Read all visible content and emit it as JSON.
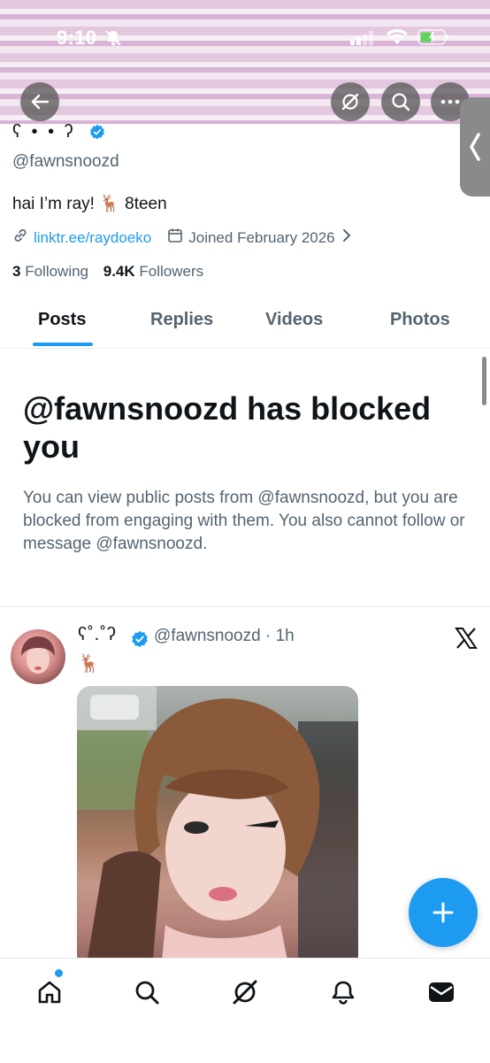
{
  "status_bar": {
    "time": "9:10"
  },
  "profile": {
    "display_name": "ʕ • • ʔ",
    "handle": "@fawnsnoozd",
    "bio": "hai I’m ray! 🦌 8teen",
    "link": "linktr.ee/raydoeko",
    "joined": "Joined February 2026",
    "following_count": "3",
    "following_label": "Following",
    "followers_count": "9.4K",
    "followers_label": "Followers"
  },
  "tabs": [
    {
      "label": "Posts",
      "active": true
    },
    {
      "label": "Replies",
      "active": false
    },
    {
      "label": "Videos",
      "active": false
    },
    {
      "label": "Photos",
      "active": false
    }
  ],
  "blocked": {
    "title": "@fawnsnoozd has blocked you",
    "description": "You can view public posts from @fawnsnoozd, but you are blocked from engaging with them. You also cannot follow or message @fawnsnoozd."
  },
  "post": {
    "author_name": "ʕ˚.˚ʔ",
    "handle_time": "@fawnsnoozd · 1h",
    "text": "🦌"
  },
  "colors": {
    "accent": "#1d9bf0",
    "text": "#0f1419",
    "muted": "#536471"
  },
  "icons": [
    "arrow-left-icon",
    "grok-icon",
    "search-icon",
    "more-icon",
    "x-logo-icon",
    "compose-icon",
    "home-icon",
    "bell-icon",
    "mail-icon"
  ]
}
